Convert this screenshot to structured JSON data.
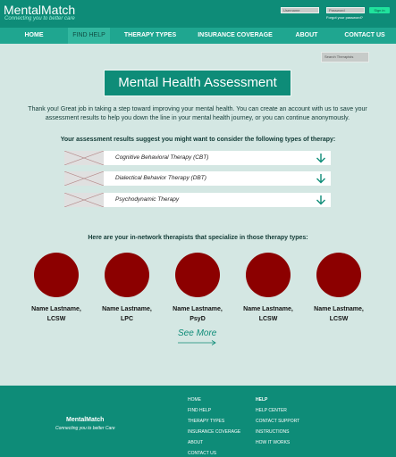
{
  "header": {
    "logo": "MentalMatch",
    "tagline": "Connecting you to better care",
    "username_placeholder": "Username",
    "password_placeholder": "Password",
    "forgot_password": "Forgot your password?",
    "signin_label": "Sign in"
  },
  "nav": {
    "items": [
      {
        "label": "HOME"
      },
      {
        "label": "FIND HELP"
      },
      {
        "label": "THERAPY TYPES"
      },
      {
        "label": "INSURANCE COVERAGE"
      },
      {
        "label": "ABOUT"
      },
      {
        "label": "CONTACT US"
      }
    ],
    "active_index": 1
  },
  "search": {
    "placeholder": "Search Therapists"
  },
  "main": {
    "title": "Mental Health Assessment",
    "intro": "Thank you! Great job in taking a step toward improving your mental health. You can create an account with us to save your assessment results to help you down the line in your mental health journey, or you can continue anonymously.",
    "results_heading": "Your assessment results suggest you might want to consider the following types of therapy:",
    "therapies": [
      {
        "label": "Cognitive Behavioral Therapy (CBT)",
        "icon": "chevron-down-icon"
      },
      {
        "label": "Dialectical Behavior Therapy (DBT)",
        "icon": "chevron-down-icon"
      },
      {
        "label": "Psychodynamic Therapy",
        "icon": "chevron-down-icon"
      }
    ],
    "therapists_heading": "Here are your in-network therapists that specialize in those therapy types:",
    "therapists": [
      {
        "name": "Name Lastname,",
        "credential": "LCSW"
      },
      {
        "name": "Name Lastname,",
        "credential": "LPC"
      },
      {
        "name": "Name Lastname,",
        "credential": "PsyD"
      },
      {
        "name": "Name Lastname,",
        "credential": "LCSW"
      },
      {
        "name": "Name Lastname,",
        "credential": "LCSW"
      }
    ],
    "see_more": "See More"
  },
  "footer": {
    "brand": "MentalMatch",
    "tagline": "Connecting you to better Care",
    "col1": [
      "HOME",
      "FIND HELP",
      "THERAPY TYPES",
      "INSURANCE COVERAGE",
      "ABOUT",
      "CONTACT US"
    ],
    "col2_heading": "HELP",
    "col2": [
      "HELP CENTER",
      "CONTACT SUPPORT",
      "INSTRUCTIONS",
      "HOW IT WORKS"
    ]
  },
  "colors": {
    "primary": "#0e8c78",
    "nav": "#1fa690",
    "background": "#d4e7e3",
    "avatar": "#8c0000",
    "signin": "#20e39d"
  }
}
